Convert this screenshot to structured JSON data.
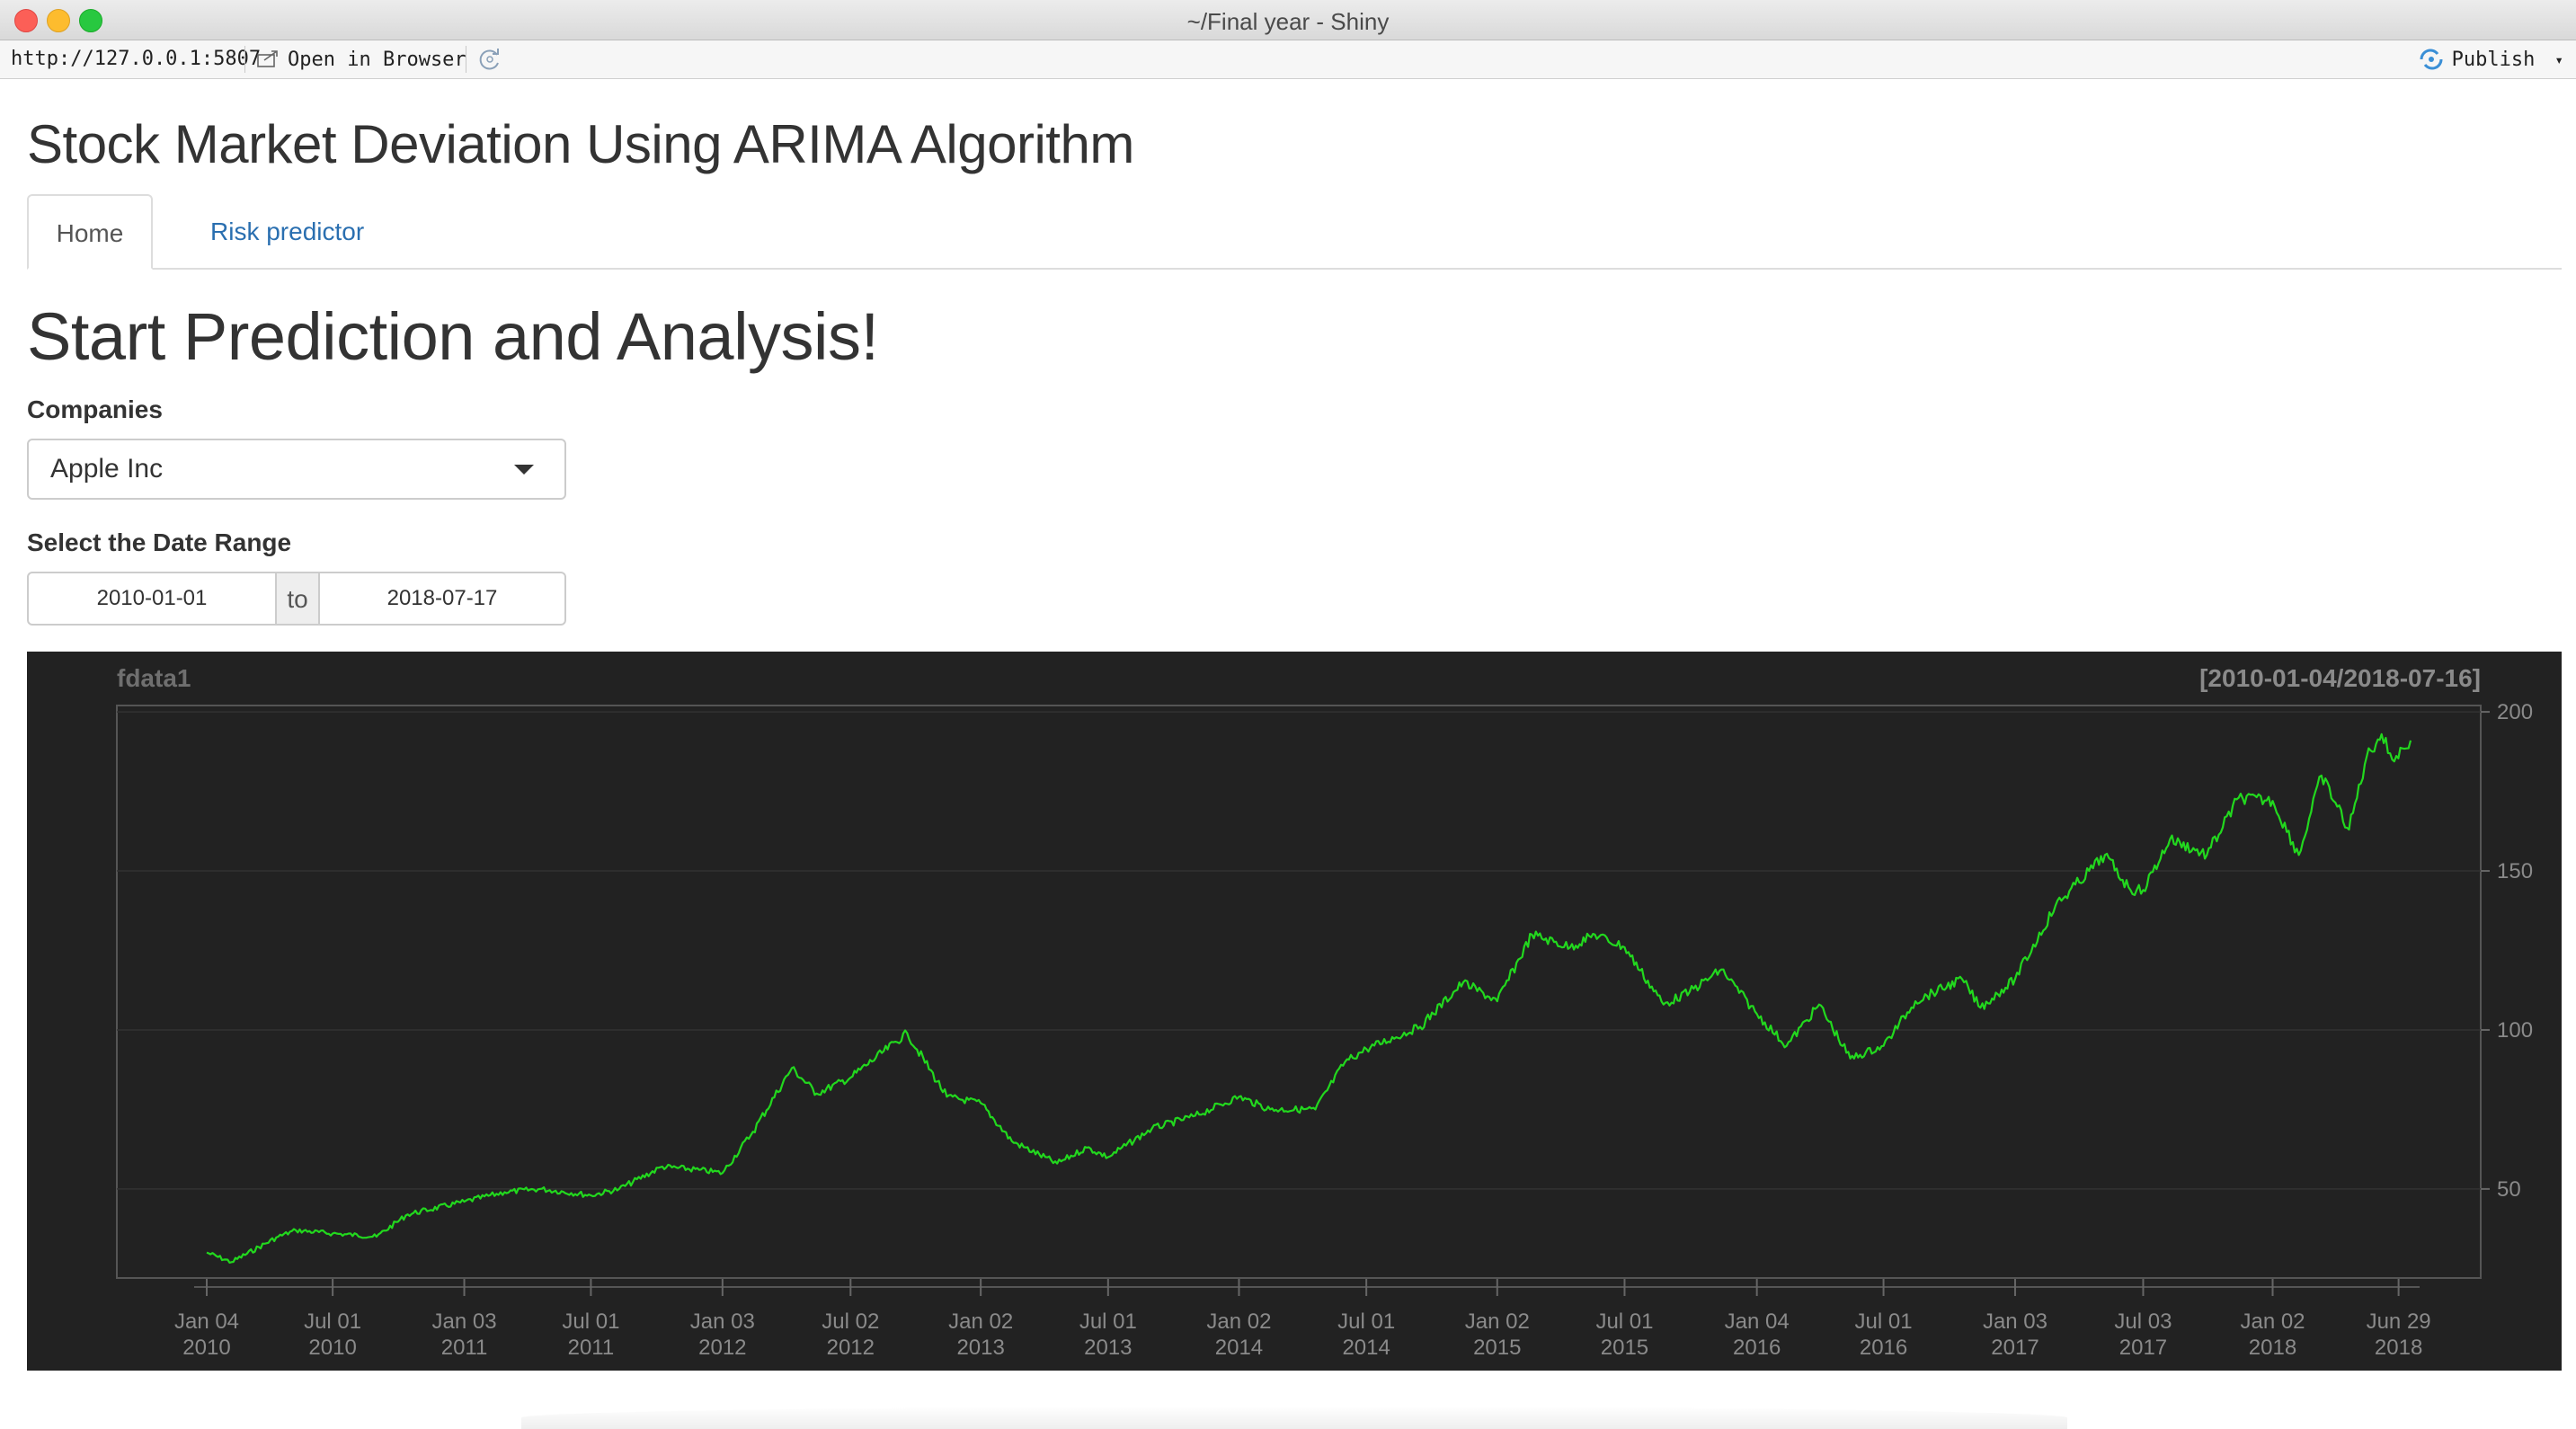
{
  "window": {
    "title": "~/Final year - Shiny"
  },
  "toolbar": {
    "url": "http://127.0.0.1:5807",
    "open_browser_label": "Open in Browser",
    "publish_label": "Publish"
  },
  "app": {
    "title": "Stock Market Deviation Using ARIMA Algorithm"
  },
  "tabs": [
    {
      "label": "Home",
      "active": true
    },
    {
      "label": "Risk predictor",
      "active": false
    }
  ],
  "home": {
    "heading": "Start Prediction and Analysis!",
    "companies_label": "Companies",
    "company_selected": "Apple Inc",
    "date_range_label": "Select the Date Range",
    "date_start": "2010-01-01",
    "date_to": "to",
    "date_end": "2018-07-17"
  },
  "colors": {
    "chart_bg": "#222222",
    "series": "#22d81e",
    "link": "#2a6fb0"
  },
  "icons": [
    "open-in-browser-icon",
    "refresh-icon",
    "publish-icon",
    "dropdown-caret-icon"
  ],
  "chart_data": {
    "type": "line",
    "title": "fdata1",
    "range_label": "[2010-01-04/2018-07-16]",
    "y_ticks": [
      50,
      100,
      150,
      200
    ],
    "ylim": [
      22,
      202
    ],
    "x_ticks": [
      {
        "label": [
          "Jan 04",
          "2010"
        ],
        "x": "2010-01-04"
      },
      {
        "label": [
          "Jul 01",
          "2010"
        ],
        "x": "2010-07-01"
      },
      {
        "label": [
          "Jan 03",
          "2011"
        ],
        "x": "2011-01-03"
      },
      {
        "label": [
          "Jul 01",
          "2011"
        ],
        "x": "2011-07-01"
      },
      {
        "label": [
          "Jan 03",
          "2012"
        ],
        "x": "2012-01-03"
      },
      {
        "label": [
          "Jul 02",
          "2012"
        ],
        "x": "2012-07-02"
      },
      {
        "label": [
          "Jan 02",
          "2013"
        ],
        "x": "2013-01-02"
      },
      {
        "label": [
          "Jul 01",
          "2013"
        ],
        "x": "2013-07-01"
      },
      {
        "label": [
          "Jan 02",
          "2014"
        ],
        "x": "2014-01-02"
      },
      {
        "label": [
          "Jul 01",
          "2014"
        ],
        "x": "2014-07-01"
      },
      {
        "label": [
          "Jan 02",
          "2015"
        ],
        "x": "2015-01-02"
      },
      {
        "label": [
          "Jul 01",
          "2015"
        ],
        "x": "2015-07-01"
      },
      {
        "label": [
          "Jan 04",
          "2016"
        ],
        "x": "2016-01-04"
      },
      {
        "label": [
          "Jul 01",
          "2016"
        ],
        "x": "2016-07-01"
      },
      {
        "label": [
          "Jan 03",
          "2017"
        ],
        "x": "2017-01-03"
      },
      {
        "label": [
          "Jul 03",
          "2017"
        ],
        "x": "2017-07-03"
      },
      {
        "label": [
          "Jan 02",
          "2018"
        ],
        "x": "2018-01-02"
      },
      {
        "label": [
          "Jun 29",
          "2018"
        ],
        "x": "2018-06-29"
      }
    ],
    "x_range": [
      "2010-01-04",
      "2018-07-16"
    ],
    "grid": true,
    "series": [
      {
        "values": [
          [
            "2010-01-04",
            30
          ],
          [
            "2010-02-08",
            27
          ],
          [
            "2010-04-15",
            35
          ],
          [
            "2010-05-10",
            37
          ],
          [
            "2010-07-01",
            36
          ],
          [
            "2010-09-01",
            35
          ],
          [
            "2010-10-15",
            42
          ],
          [
            "2011-01-03",
            46
          ],
          [
            "2011-03-01",
            49
          ],
          [
            "2011-04-20",
            50
          ],
          [
            "2011-07-01",
            48
          ],
          [
            "2011-08-10",
            50
          ],
          [
            "2011-10-10",
            57
          ],
          [
            "2011-12-01",
            56
          ],
          [
            "2012-01-03",
            55
          ],
          [
            "2012-02-15",
            68
          ],
          [
            "2012-04-10",
            88
          ],
          [
            "2012-05-15",
            80
          ],
          [
            "2012-07-02",
            85
          ],
          [
            "2012-09-20",
            99
          ],
          [
            "2012-11-15",
            79
          ],
          [
            "2013-01-02",
            77
          ],
          [
            "2013-02-15",
            65
          ],
          [
            "2013-04-20",
            58
          ],
          [
            "2013-06-01",
            63
          ],
          [
            "2013-07-01",
            60
          ],
          [
            "2013-09-01",
            69
          ],
          [
            "2013-11-01",
            73
          ],
          [
            "2014-01-02",
            79
          ],
          [
            "2014-02-15",
            75
          ],
          [
            "2014-04-20",
            75
          ],
          [
            "2014-06-01",
            90
          ],
          [
            "2014-07-01",
            94
          ],
          [
            "2014-09-15",
            101
          ],
          [
            "2014-11-15",
            115
          ],
          [
            "2015-01-02",
            109
          ],
          [
            "2015-02-20",
            130
          ],
          [
            "2015-04-15",
            126
          ],
          [
            "2015-05-20",
            130
          ],
          [
            "2015-07-01",
            126
          ],
          [
            "2015-08-25",
            108
          ],
          [
            "2015-10-01",
            112
          ],
          [
            "2015-11-15",
            119
          ],
          [
            "2016-01-04",
            105
          ],
          [
            "2016-02-15",
            95
          ],
          [
            "2016-04-01",
            108
          ],
          [
            "2016-05-15",
            91
          ],
          [
            "2016-07-01",
            95
          ],
          [
            "2016-08-15",
            109
          ],
          [
            "2016-10-20",
            116
          ],
          [
            "2016-11-15",
            107
          ],
          [
            "2017-01-03",
            116
          ],
          [
            "2017-03-01",
            139
          ],
          [
            "2017-05-10",
            155
          ],
          [
            "2017-06-15",
            144
          ],
          [
            "2017-07-03",
            144
          ],
          [
            "2017-08-10",
            160
          ],
          [
            "2017-10-01",
            155
          ],
          [
            "2017-11-15",
            173
          ],
          [
            "2018-01-02",
            172
          ],
          [
            "2018-02-08",
            155
          ],
          [
            "2018-03-12",
            180
          ],
          [
            "2018-04-20",
            163
          ],
          [
            "2018-05-15",
            186
          ],
          [
            "2018-06-05",
            193
          ],
          [
            "2018-06-20",
            185
          ],
          [
            "2018-07-16",
            191
          ]
        ]
      }
    ]
  }
}
